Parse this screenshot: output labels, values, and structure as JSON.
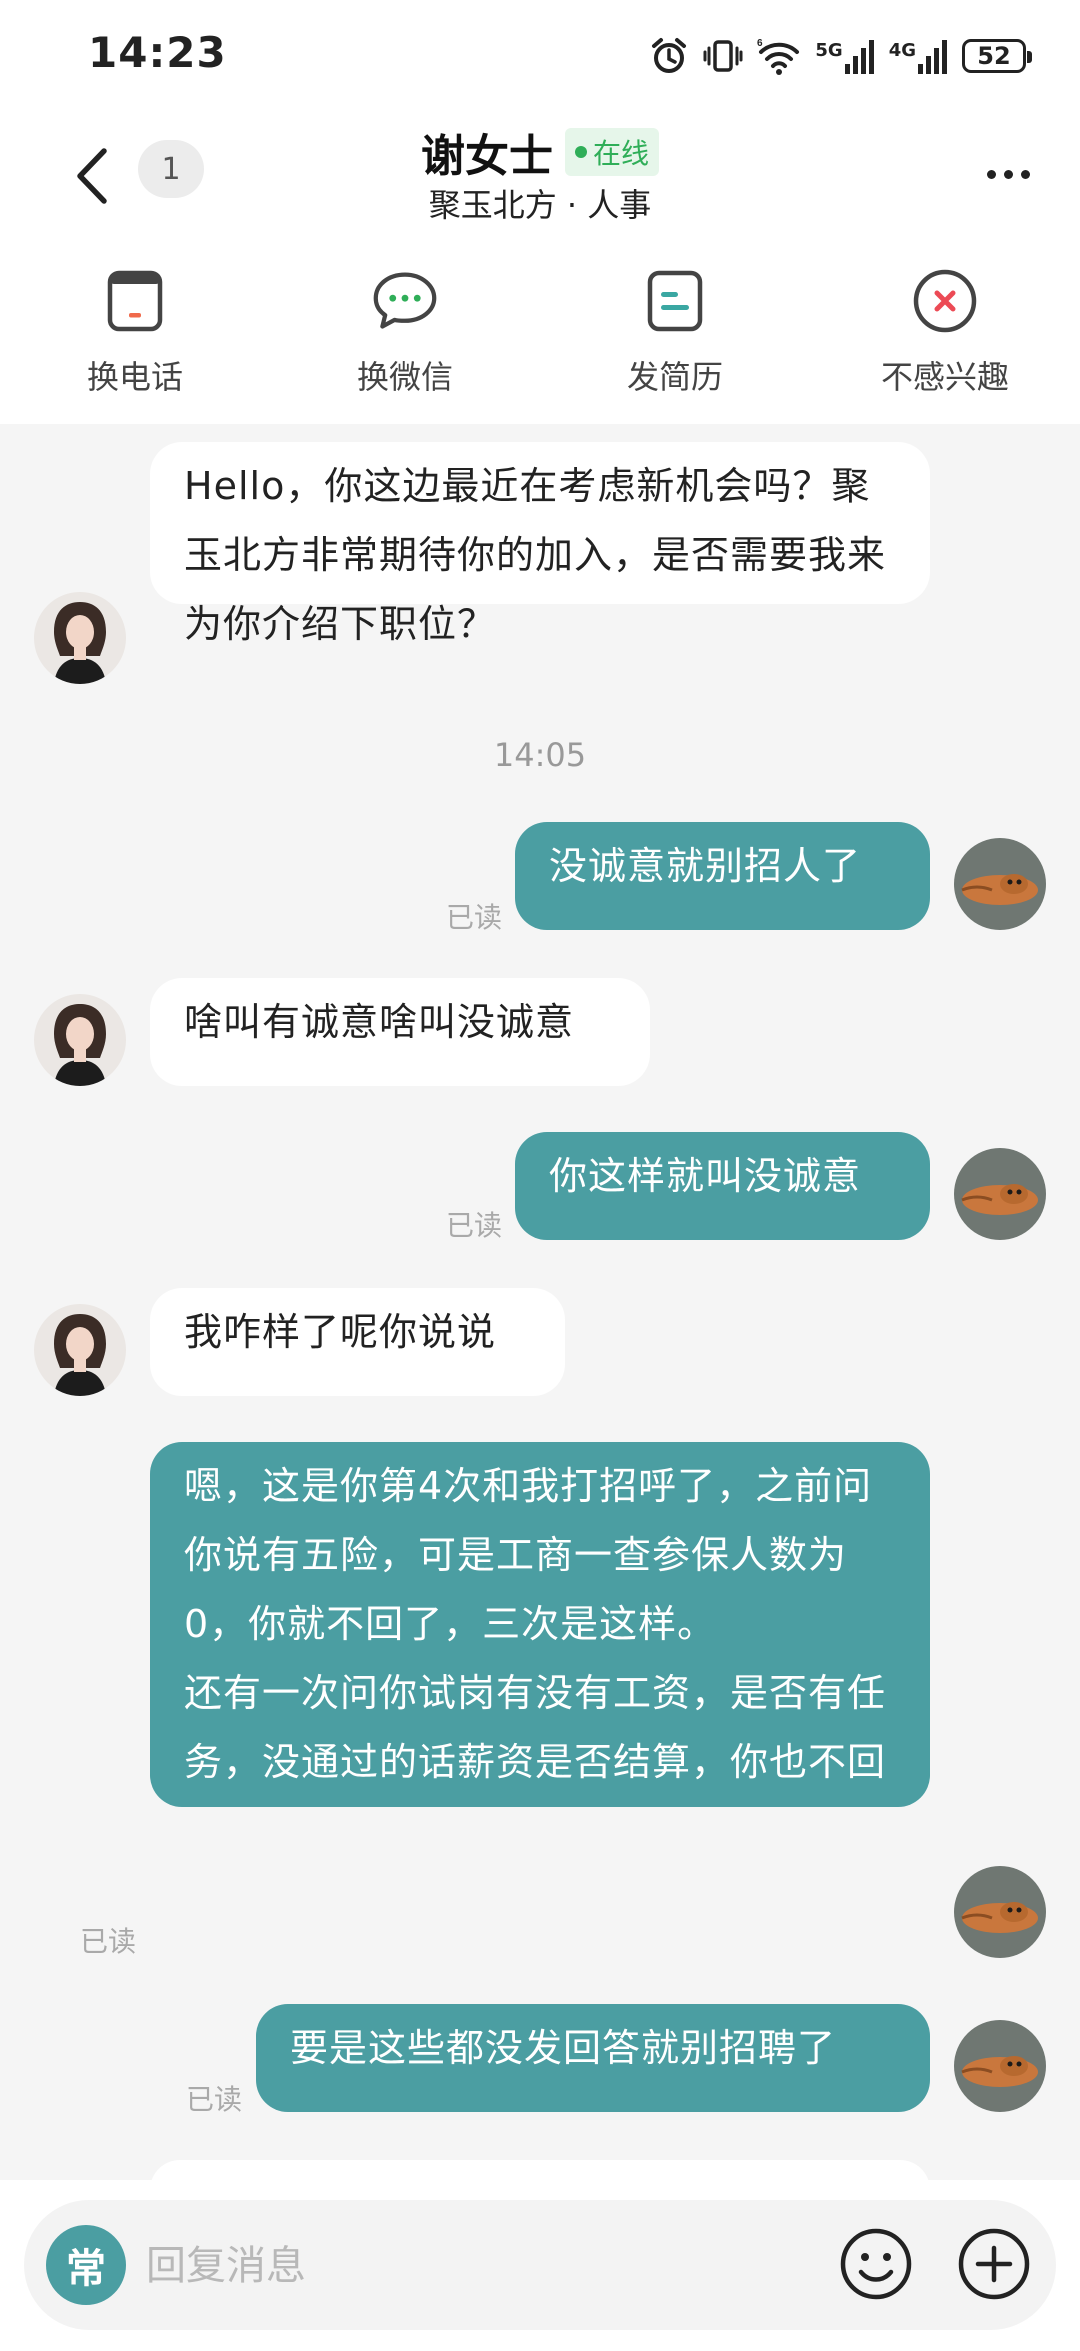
{
  "status_bar": {
    "time": "14:23",
    "net_5g": "5G",
    "net_4g": "4G",
    "battery": "52"
  },
  "header": {
    "back_icon": "back-chevron-icon",
    "unread_count": "1",
    "contact_name": "谢女士",
    "online_status": "在线",
    "subtitle": "聚玉北方 · 人事",
    "more_icon": "more-dots-icon"
  },
  "actions": [
    {
      "label": "换电话",
      "icon": "phone-swap-icon"
    },
    {
      "label": "换微信",
      "icon": "wechat-icon"
    },
    {
      "label": "发简历",
      "icon": "resume-icon"
    },
    {
      "label": "不感兴趣",
      "icon": "not-interested-icon"
    }
  ],
  "messages": [
    {
      "side": "in",
      "text": "Hello，你这边最近在考虑新机会吗？聚玉北方非常期待你的加入，是否需要我来为你介绍下职位？"
    },
    {
      "side": "out",
      "text": "没诚意就别招人了",
      "status": "已读"
    },
    {
      "side": "in",
      "text": "啥叫有诚意啥叫没诚意"
    },
    {
      "side": "out",
      "text": "你这样就叫没诚意",
      "status": "已读"
    },
    {
      "side": "in",
      "text": "我咋样了呢你说说"
    },
    {
      "side": "out",
      "text": "嗯，这是你第4次和我打招呼了，之前问你说有五险，可是工商一查参保人数为0，你就不回了，三次是这样。\n还有一次问你试岗有没有工资，是否有任务，没通过的话薪资是否结算，你也不回",
      "status": "已读"
    },
    {
      "side": "out",
      "text": "要是这些都没发回答就别招聘了",
      "status": "已读"
    }
  ],
  "timestamp": "14:05",
  "input": {
    "common_label": "常",
    "placeholder": "回复消息",
    "emoji_icon": "emoji-icon",
    "plus_icon": "plus-icon"
  },
  "colors": {
    "accent": "#4b9ea2",
    "online": "#2fae58",
    "background": "#f5f5f5",
    "incoming_bubble": "#ffffff",
    "read_label": "#a9a9a9"
  }
}
